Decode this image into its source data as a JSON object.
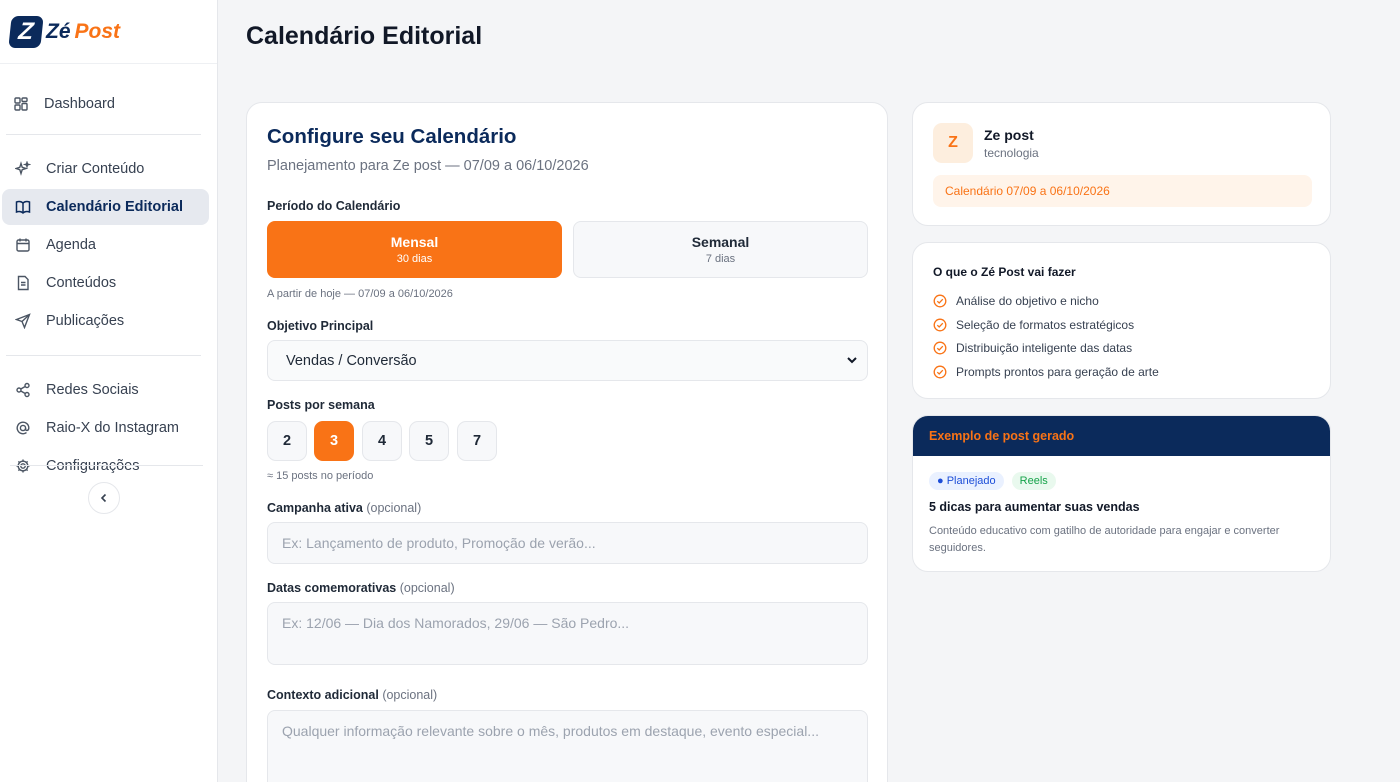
{
  "brand": {
    "mark": "Z",
    "name_ze": "Zé",
    "name_post": "Post",
    "accent": "#f97316",
    "navy": "#0b2a5b"
  },
  "sidebar": {
    "groups": [
      [
        {
          "label": "Dashboard",
          "icon": "dashboard-icon"
        }
      ],
      [
        {
          "label": "Criar Conteúdo",
          "icon": "sparkles-icon"
        },
        {
          "label": "Calendário Editorial",
          "icon": "book-icon",
          "active": true
        },
        {
          "label": "Agenda",
          "icon": "calendar-icon"
        },
        {
          "label": "Conteúdos",
          "icon": "document-icon"
        },
        {
          "label": "Publicações",
          "icon": "send-icon"
        }
      ],
      [
        {
          "label": "Redes Sociais",
          "icon": "share-icon"
        },
        {
          "label": "Raio-X do Instagram",
          "icon": "at-icon"
        },
        {
          "label": "Configurações",
          "icon": "gear-icon"
        }
      ]
    ]
  },
  "page": {
    "title": "Calendário Editorial"
  },
  "config": {
    "title": "Configure seu Calendário",
    "subtitle": "Planejamento para Ze post — 07/09 a 06/10/2026",
    "period_label": "Período do Calendário",
    "period_options": [
      {
        "title": "Mensal",
        "sub": "30 dias",
        "selected": true
      },
      {
        "title": "Semanal",
        "sub": "7 dias",
        "selected": false
      }
    ],
    "period_hint": "A partir de hoje — 07/09 a 06/10/2026",
    "objective_label": "Objetivo Principal",
    "objective_value": "Vendas / Conversão",
    "posts_label": "Posts por semana",
    "posts_options": [
      "2",
      "3",
      "4",
      "5",
      "7"
    ],
    "posts_selected": "3",
    "posts_hint": "≈ 15 posts no período",
    "campaign_label": "Campanha ativa",
    "campaign_optional": "(opcional)",
    "campaign_placeholder": "Ex: Lançamento de produto, Promoção de verão...",
    "dates_label": "Datas comemorativas",
    "dates_optional": "(opcional)",
    "dates_placeholder": "Ex: 12/06 — Dia dos Namorados, 29/06 — São Pedro...",
    "context_label": "Contexto adicional",
    "context_optional": "(opcional)",
    "context_placeholder": "Qualquer informação relevante sobre o mês, produtos em destaque, evento especial..."
  },
  "profile": {
    "initial": "Z",
    "name": "Ze post",
    "niche": "tecnologia",
    "calendar_range": "Calendário 07/09 a 06/10/2026"
  },
  "features": {
    "title": "O que o Zé Post vai fazer",
    "items": [
      "Análise do objetivo e nicho",
      "Seleção de formatos estratégicos",
      "Distribuição inteligente das datas",
      "Prompts prontos para geração de arte"
    ]
  },
  "example": {
    "header": "Exemplo de post gerado",
    "badge_status": "● Planejado",
    "badge_format": "Reels",
    "title": "5 dicas para aumentar suas vendas",
    "description": "Conteúdo educativo com gatilho de autoridade para engajar e converter seguidores."
  }
}
